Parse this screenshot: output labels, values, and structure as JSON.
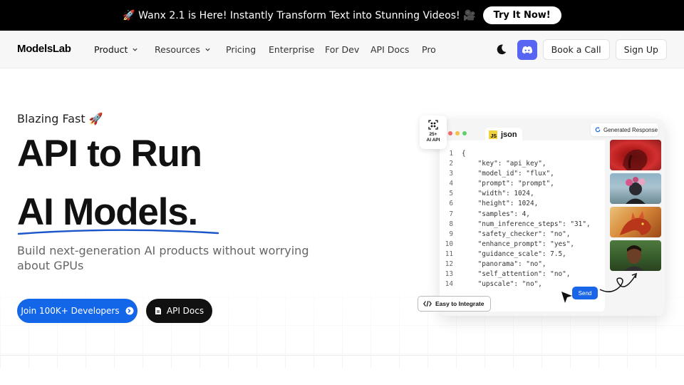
{
  "announcement": {
    "text": "🚀 Wanx 2.1 is Here! Instantly Transform Text into Stunning Videos! 🎥",
    "cta_label": "Try It Now!"
  },
  "nav": {
    "logo": "ModelsLab",
    "items": [
      {
        "label": "Product",
        "has_dropdown": true
      },
      {
        "label": "Resources",
        "has_dropdown": true
      },
      {
        "label": "Pricing",
        "has_dropdown": false
      },
      {
        "label": "Enterprise",
        "has_dropdown": false
      },
      {
        "label": "For Dev",
        "has_dropdown": false
      },
      {
        "label": "API Docs",
        "has_dropdown": false
      },
      {
        "label": "Pro",
        "has_dropdown": false
      }
    ],
    "theme_icon": "moon-icon",
    "discord_icon": "discord-icon",
    "book_call_label": "Book a Call",
    "signup_label": "Sign Up"
  },
  "hero": {
    "eyebrow": "Blazing Fast 🚀",
    "headline_line1": "API to Run",
    "headline_line2": "AI Models.",
    "subheading": "Build next-generation AI products without worrying about GPUs",
    "primary_cta": "Join 100K+ Developers",
    "secondary_cta": "API Docs"
  },
  "code_card": {
    "tab_badge": "JS",
    "tab_label": "json",
    "ai_badge_count": "25+",
    "ai_badge_label": "AI API",
    "generated_label": "Generated Response",
    "easy_label": "Easy to Integrate",
    "send_label": "Send",
    "lines": [
      {
        "n": "1",
        "t": "{"
      },
      {
        "n": "2",
        "t": "    \"key\": \"api_key\","
      },
      {
        "n": "3",
        "t": "    \"model_id\": \"flux\","
      },
      {
        "n": "4",
        "t": "    \"prompt\": \"prompt\","
      },
      {
        "n": "5",
        "t": "    \"width\": 1024,"
      },
      {
        "n": "6",
        "t": "    \"height\": 1024,"
      },
      {
        "n": "7",
        "t": "    \"samples\": 4,"
      },
      {
        "n": "8",
        "t": "    \"num_inference_steps\": \"31\","
      },
      {
        "n": "9",
        "t": "    \"safety_checker\": \"no\","
      },
      {
        "n": "10",
        "t": "    \"enhance_prompt\": \"yes\","
      },
      {
        "n": "11",
        "t": "    \"guidance_scale\": 7.5,"
      },
      {
        "n": "12",
        "t": "    \"panorama\": \"no\","
      },
      {
        "n": "13",
        "t": "    \"self_attention\": \"no\","
      },
      {
        "n": "14",
        "t": "    \"upscale\": \"no\","
      }
    ]
  },
  "colors": {
    "brand_blue": "#1366e8",
    "discord": "#5865f2",
    "announce_bg": "#000000"
  }
}
